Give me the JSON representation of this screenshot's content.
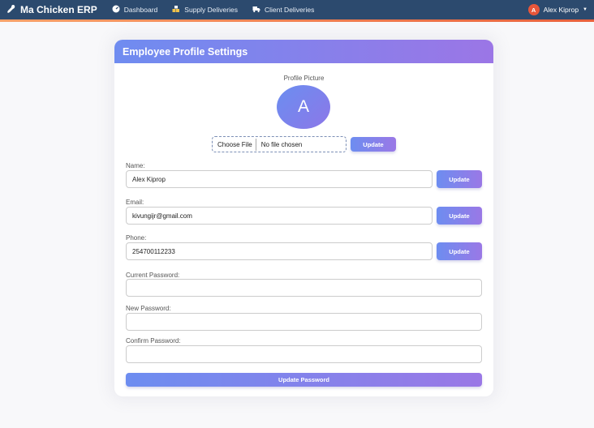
{
  "navbar": {
    "brand": "Ma Chicken ERP",
    "links": [
      {
        "label": "Dashboard",
        "icon": "dashboard-icon"
      },
      {
        "label": "Supply Deliveries",
        "icon": "supply-icon"
      },
      {
        "label": "Client Deliveries",
        "icon": "truck-icon"
      }
    ],
    "user": {
      "initial": "A",
      "name": "Alex Kiprop"
    }
  },
  "card": {
    "title": "Employee Profile Settings",
    "profile_picture_label": "Profile Picture",
    "avatar_initial": "A",
    "file_button": "Choose File",
    "file_status": "No file chosen",
    "upload_button": "Update",
    "fields": {
      "name": {
        "label": "Name:",
        "value": "Alex Kiprop",
        "button": "Update"
      },
      "email": {
        "label": "Email:",
        "value": "kivungijr@gmail.com",
        "button": "Update"
      },
      "phone": {
        "label": "Phone:",
        "value": "254700112233",
        "button": "Update"
      },
      "current_password": {
        "label": "Current Password:",
        "value": ""
      },
      "new_password": {
        "label": "New Password:",
        "value": ""
      },
      "confirm_password": {
        "label": "Confirm Password:",
        "value": ""
      }
    },
    "update_password_button": "Update Password"
  },
  "colors": {
    "navbar": "#2c4a6e",
    "accent_bar": "#e8613c",
    "gradient_start": "#6f8cf0",
    "gradient_end": "#9b76e6",
    "user_avatar": "#e8563a"
  }
}
